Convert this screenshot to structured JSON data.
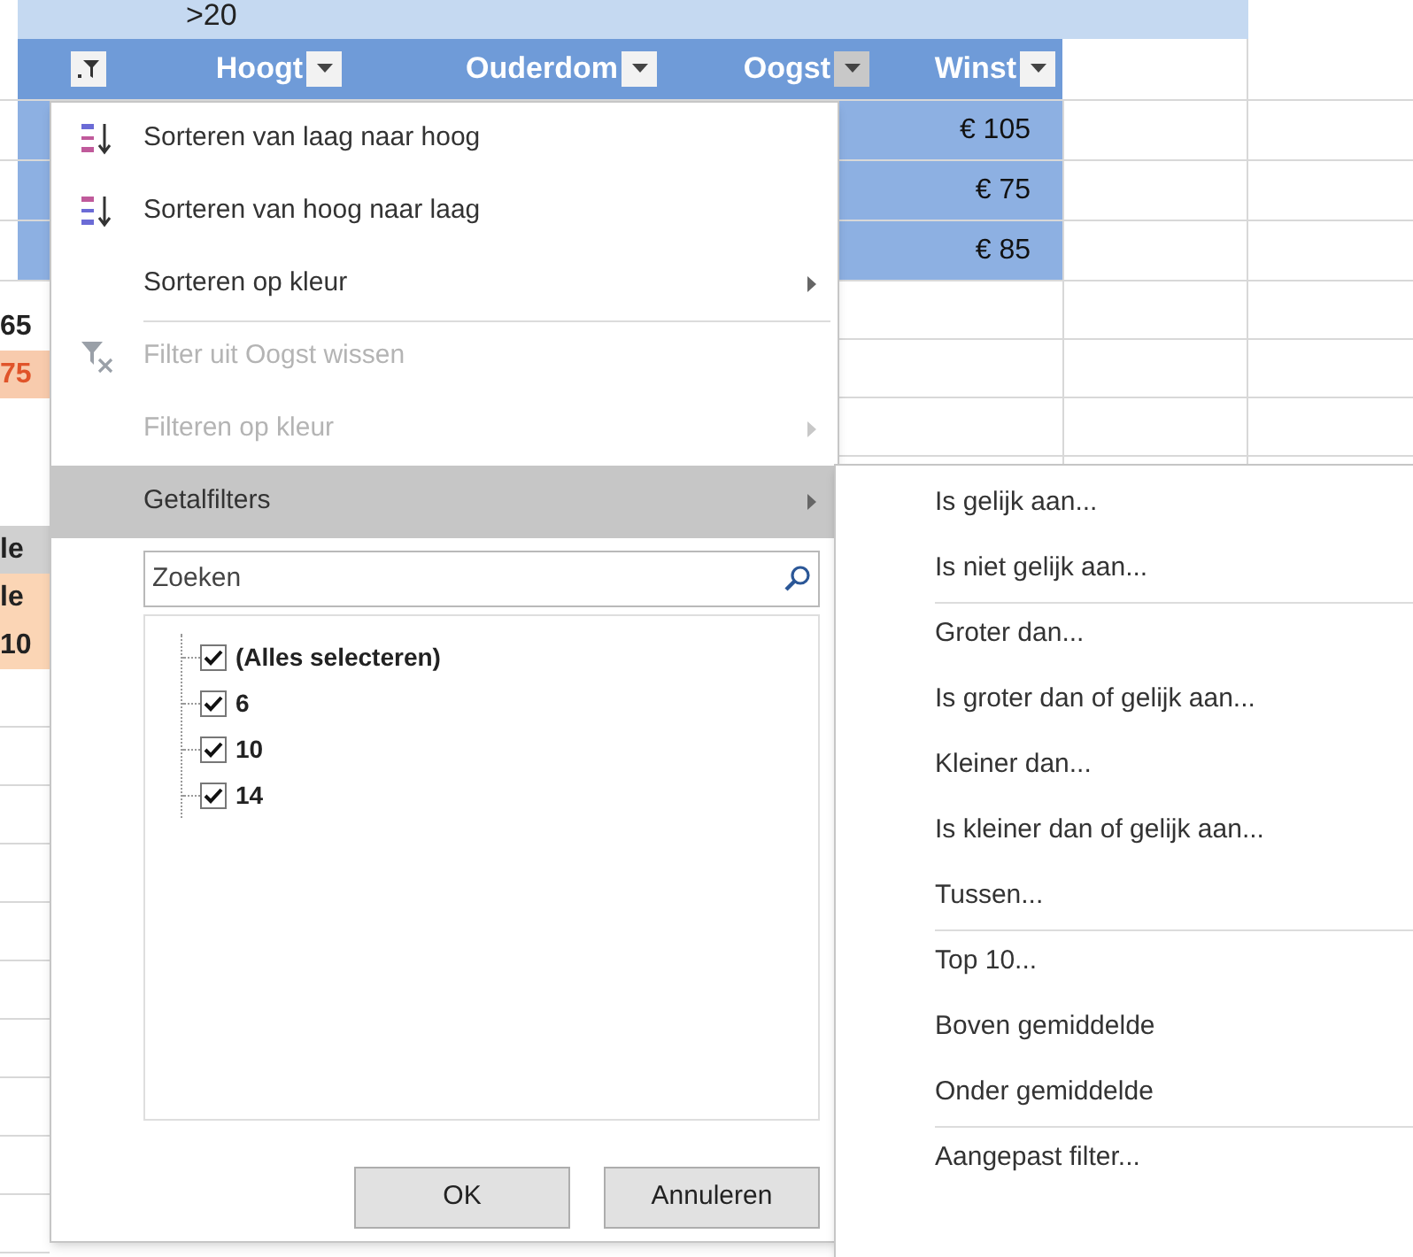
{
  "top_band": {
    "text": ">20"
  },
  "columns": [
    {
      "label": "Hoogt",
      "menu_open": false
    },
    {
      "label": "Ouderdom",
      "menu_open": false
    },
    {
      "label": "Oogst",
      "menu_open": true
    },
    {
      "label": "Winst",
      "menu_open": false
    }
  ],
  "filtered_column": {
    "filter_active": true
  },
  "winst_values": [
    "€ 105",
    "€ 75",
    "€ 85"
  ],
  "left_edge_cells": [
    {
      "text": "65",
      "kind": "plain"
    },
    {
      "text": "75",
      "kind": "accent"
    },
    {
      "text": "le",
      "kind": "shaded"
    },
    {
      "text": "le",
      "kind": "highlight"
    },
    {
      "text": "10",
      "kind": "highlight"
    }
  ],
  "filter_menu": {
    "items": [
      {
        "label": "Sorteren van laag naar hoog",
        "kind": "ascending",
        "submenu": false,
        "disabled": false,
        "selected": false,
        "separator_before": false
      },
      {
        "label": "Sorteren van hoog naar laag",
        "kind": "descending",
        "submenu": false,
        "disabled": false,
        "selected": false,
        "separator_before": false
      },
      {
        "label": "Sorteren op kleur",
        "kind": "plain",
        "submenu": true,
        "disabled": false,
        "selected": false,
        "separator_before": false
      },
      {
        "label": "Filter uit Oogst wissen",
        "kind": "clear",
        "submenu": false,
        "disabled": true,
        "selected": false,
        "separator_before": true
      },
      {
        "label": "Filteren op kleur",
        "kind": "plain",
        "submenu": true,
        "disabled": true,
        "selected": false,
        "separator_before": false
      },
      {
        "label": "Getalfilters",
        "kind": "plain",
        "submenu": true,
        "disabled": false,
        "selected": true,
        "separator_before": false
      }
    ],
    "search": {
      "placeholder": "Zoeken"
    },
    "values": [
      {
        "label": "(Alles selecteren)",
        "checked": true
      },
      {
        "label": "6",
        "checked": true
      },
      {
        "label": "10",
        "checked": true
      },
      {
        "label": "14",
        "checked": true
      }
    ],
    "buttons": [
      "OK",
      "Annuleren"
    ]
  },
  "submenu": [
    {
      "label": "Is gelijk aan...",
      "separator_before": false
    },
    {
      "label": "Is niet gelijk aan...",
      "separator_before": false
    },
    {
      "label": "Groter dan...",
      "separator_before": true
    },
    {
      "label": "Is groter dan of gelijk aan...",
      "separator_before": false
    },
    {
      "label": "Kleiner dan...",
      "separator_before": false
    },
    {
      "label": "Is kleiner dan of gelijk aan...",
      "separator_before": false
    },
    {
      "label": "Tussen...",
      "separator_before": false
    },
    {
      "label": "Top 10...",
      "separator_before": true
    },
    {
      "label": "Boven gemiddelde",
      "separator_before": false
    },
    {
      "label": "Onder gemiddelde",
      "separator_before": false
    },
    {
      "label": "Aangepast filter...",
      "separator_before": true
    }
  ]
}
